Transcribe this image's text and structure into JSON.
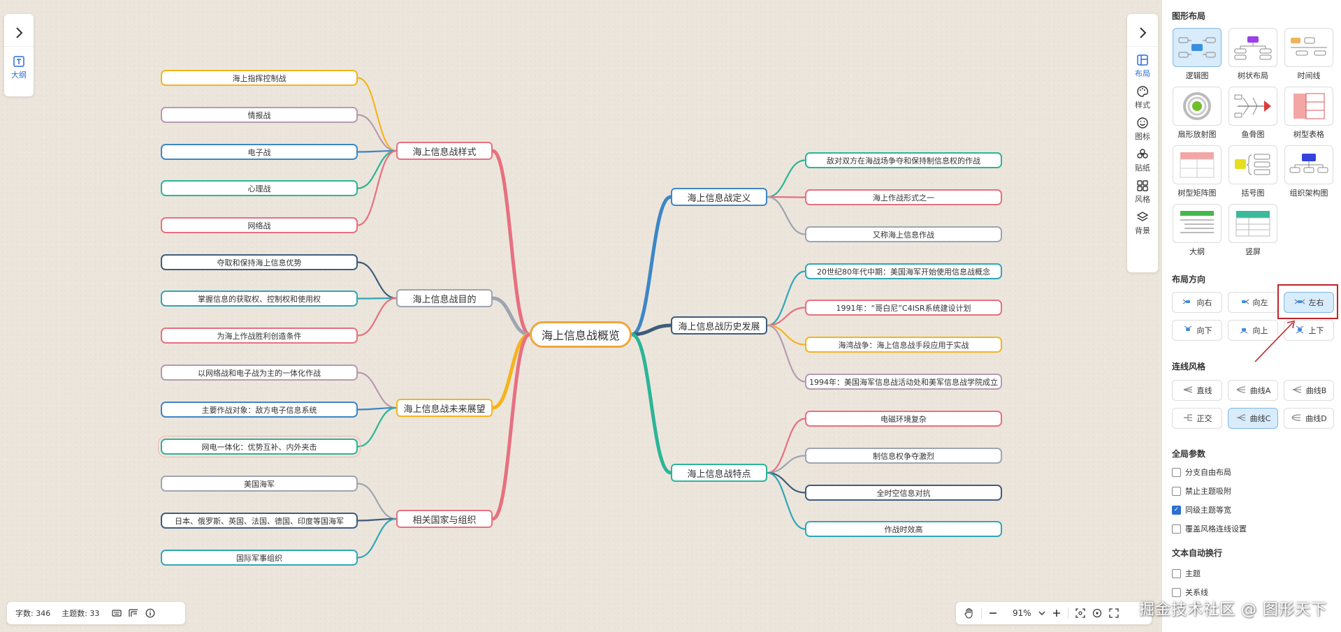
{
  "left_sidebar": {
    "outline_label": "大纲"
  },
  "mindmap": {
    "root": "海上信息战概览",
    "left_branches": [
      {
        "label": "海上信息战样式",
        "color": "#e7707f",
        "children": [
          {
            "label": "海上指挥控制战",
            "color": "#f5b41c"
          },
          {
            "label": "情报战",
            "color": "#b79ab2"
          },
          {
            "label": "电子战",
            "color": "#3d86c6"
          },
          {
            "label": "心理战",
            "color": "#2bb597"
          },
          {
            "label": "网络战",
            "color": "#e7707f"
          }
        ]
      },
      {
        "label": "海上信息战目的",
        "color": "#9da5b0",
        "children": [
          {
            "label": "夺取和保持海上信息优势",
            "color": "#3e5d7a"
          },
          {
            "label": "掌握信息的获取权、控制权和使用权",
            "color": "#2fa7b8"
          },
          {
            "label": "为海上作战胜利创造条件",
            "color": "#e7707f"
          }
        ]
      },
      {
        "label": "海上信息战未来展望",
        "color": "#f5b41c",
        "children": [
          {
            "label": "以网络战和电子战为主的一体化作战",
            "color": "#b79ab2"
          },
          {
            "label": "主要作战对象：敌方电子信息系统",
            "color": "#3d86c6"
          },
          {
            "label": "网电一体化：优势互补、内外夹击",
            "color": "#2bb597"
          }
        ]
      },
      {
        "label": "相关国家与组织",
        "color": "#e7707f",
        "children": [
          {
            "label": "美国海军",
            "color": "#9da5b0"
          },
          {
            "label": "日本、俄罗斯、英国、法国、德国、印度等国海军",
            "color": "#3e5d7a"
          },
          {
            "label": "国际军事组织",
            "color": "#2fa7b8"
          }
        ]
      }
    ],
    "right_branches": [
      {
        "label": "海上信息战定义",
        "color": "#3d86c6",
        "children": [
          {
            "label": "敌对双方在海战场争夺和保持制信息权的作战",
            "color": "#2bb597"
          },
          {
            "label": "海上作战形式之一",
            "color": "#e7707f"
          },
          {
            "label": "又称海上信息作战",
            "color": "#9da5b0"
          }
        ]
      },
      {
        "label": "海上信息战历史发展",
        "color": "#3e5d7a",
        "children": [
          {
            "label": "20世纪80年代中期：美国海军开始使用信息战概念",
            "color": "#2fa7b8"
          },
          {
            "label": "1991年：“哥白尼”C4ISR系统建设计划",
            "color": "#e7707f"
          },
          {
            "label": "海湾战争：海上信息战手段应用于实战",
            "color": "#f5b41c"
          },
          {
            "label": "1994年：美国海军信息战活动处和美军信息战学院成立",
            "color": "#b79ab2"
          }
        ]
      },
      {
        "label": "海上信息战特点",
        "color": "#2bb597",
        "children": [
          {
            "label": "电磁环境复杂",
            "color": "#e7707f"
          },
          {
            "label": "制信息权争夺激烈",
            "color": "#9da5b0"
          },
          {
            "label": "全时空信息对抗",
            "color": "#3e5d7a"
          },
          {
            "label": "作战时效高",
            "color": "#2fa7b8"
          }
        ]
      }
    ]
  },
  "right_toolbar": {
    "items": [
      {
        "label": "布局",
        "icon": "layout-icon"
      },
      {
        "label": "样式",
        "icon": "palette-icon"
      },
      {
        "label": "图标",
        "icon": "smile-icon"
      },
      {
        "label": "贴纸",
        "icon": "sticker-icon"
      },
      {
        "label": "风格",
        "icon": "grid-icon"
      },
      {
        "label": "背景",
        "icon": "layers-icon"
      }
    ]
  },
  "panel": {
    "layout_title": "图形布局",
    "layouts": [
      "逻辑图",
      "树状布局",
      "时间线",
      "扇形放射图",
      "鱼骨图",
      "树型表格",
      "树型矩阵图",
      "括号图",
      "组织架构图",
      "大纲",
      "竖屏"
    ],
    "direction_title": "布局方向",
    "directions": [
      "向右",
      "向左",
      "左右",
      "向下",
      "向上",
      "上下"
    ],
    "line_title": "连线风格",
    "lines": [
      "直线",
      "曲线A",
      "曲线B",
      "正交",
      "曲线C",
      "曲线D"
    ],
    "global_title": "全局参数",
    "global_options": [
      {
        "label": "分支自由布局",
        "checked": false
      },
      {
        "label": "禁止主题吸附",
        "checked": false
      },
      {
        "label": "同级主题等宽",
        "checked": true
      },
      {
        "label": "覆盖风格连线设置",
        "checked": false
      }
    ],
    "wrap_title": "文本自动换行",
    "wrap_options": [
      {
        "label": "主题",
        "checked": false
      },
      {
        "label": "关系线",
        "checked": false
      }
    ]
  },
  "status": {
    "word_count": "字数: 346",
    "topic_count": "主题数: 33"
  },
  "zoom": {
    "value": "91%"
  },
  "watermark": "掘金技术社区 @ 图形天下",
  "colors": {
    "accent": "#2c6fd1",
    "highlight_box": "#c0242b"
  }
}
